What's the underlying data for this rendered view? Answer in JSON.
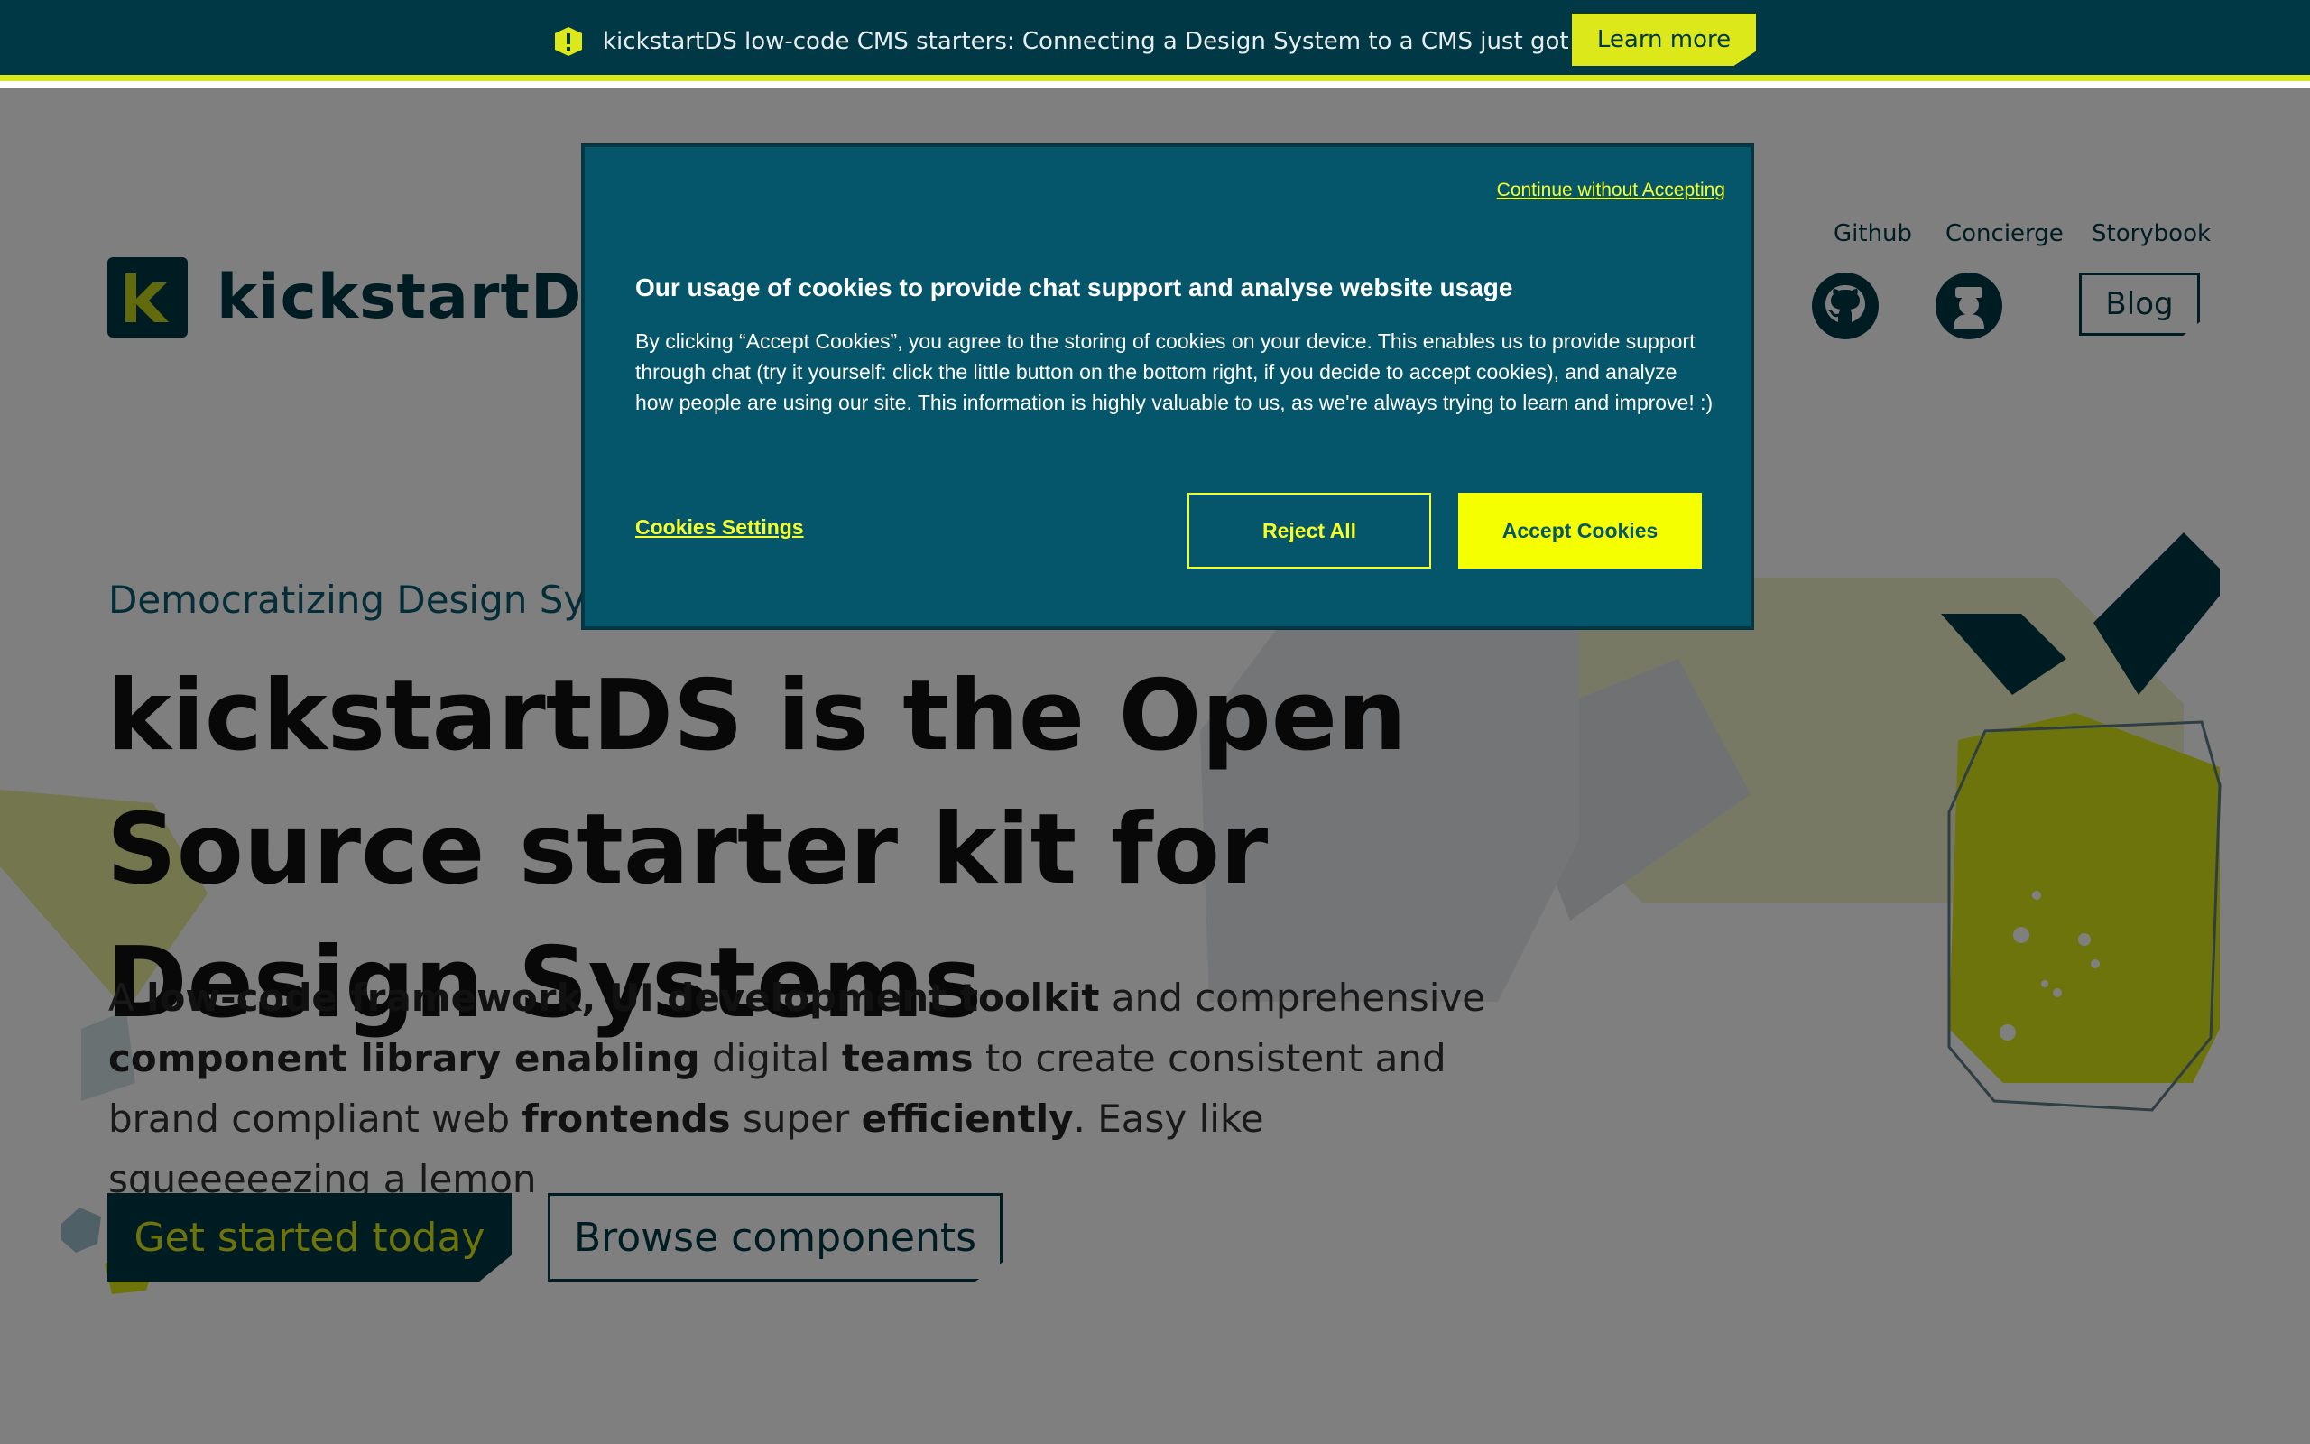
{
  "announcement": {
    "text": "kickstartDS low-code CMS starters: Connecting a Design System to a CMS just got easier",
    "cta_label": "Learn more"
  },
  "header": {
    "logo_text": "kickstartDS",
    "nav_links": [
      "Github",
      "Concierge",
      "Storybook"
    ],
    "blog_label": "Blog",
    "icons": [
      "github-icon",
      "concierge-icon"
    ]
  },
  "hero": {
    "eyebrow": "Democratizing Design Sys",
    "title": "kickstartDS is the Open Source starter kit for Design Systems",
    "copy_parts": [
      "A ",
      "low-code framework, UI development toolkit",
      " and comprehensive ",
      "component library enabling",
      " digital ",
      "teams",
      " to create consistent and brand compliant web ",
      "frontends",
      " super ",
      "efficiently",
      ". Easy like squeeeeezing a lemon"
    ],
    "primary_cta": "Get started today",
    "secondary_cta": "Browse components"
  },
  "cookie_dialog": {
    "continue_label": "Continue without Accepting",
    "title": "Our usage of cookies to provide chat support and analyse website usage",
    "body": "By clicking “Accept Cookies”, you agree to the storing of cookies on your device. This enables us to provide support through chat (try it yourself: click the little button on the bottom right, if you decide to accept cookies), and analyze how people are using our site. This information is highly valuable to us, as we're always trying to learn and improve! :)",
    "settings_label": "Cookies Settings",
    "reject_label": "Reject All",
    "accept_label": "Accept Cookies"
  },
  "colors": {
    "brand_dark": "#003846",
    "brand_lime": "#dce819",
    "dialog_bg": "#06566b",
    "accent_yellow": "#f5ff00"
  }
}
